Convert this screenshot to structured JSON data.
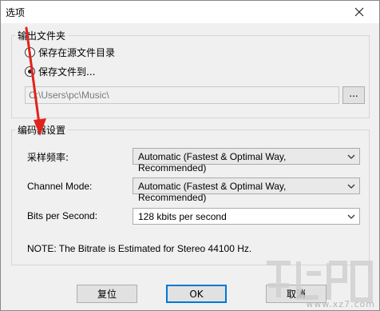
{
  "window": {
    "title": "选项"
  },
  "output_folder": {
    "group_title": "输出文件夹",
    "radio_source": "保存在源文件目录",
    "radio_save_to": "保存文件到...",
    "selected": "save_to",
    "path_value": "C:\\Users\\pc\\Music\\",
    "browse_label": "..."
  },
  "encoder": {
    "group_title": "编码器设置",
    "sample_rate_label": "采样频率:",
    "sample_rate_value": "Automatic (Fastest & Optimal Way, Recommended)",
    "channel_mode_label": "Channel Mode:",
    "channel_mode_value": "Automatic (Fastest & Optimal Way, Recommended)",
    "bits_label": "Bits per Second:",
    "bits_value": "128 kbits per second",
    "note": "NOTE: The Bitrate is Estimated  for Stereo 44100 Hz."
  },
  "buttons": {
    "reset": "复位",
    "ok": "OK",
    "cancel": "取消"
  },
  "watermark": {
    "text": "www.xz7.com"
  },
  "colors": {
    "arrow": "#e0231c",
    "focus": "#0078d7"
  },
  "icons": {
    "close": "close-icon",
    "dropdown": "chevron-down-icon"
  }
}
